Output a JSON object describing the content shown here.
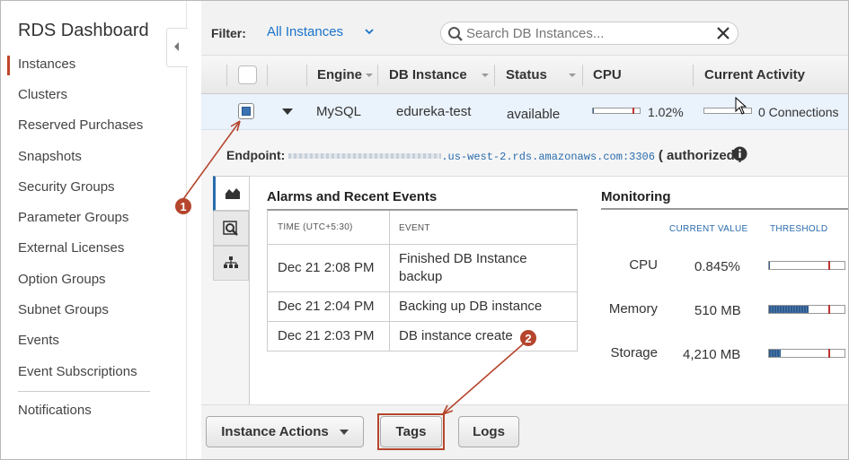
{
  "sidebar": {
    "title": "RDS Dashboard",
    "items": [
      {
        "label": "Instances"
      },
      {
        "label": "Clusters"
      },
      {
        "label": "Reserved Purchases"
      },
      {
        "label": "Snapshots"
      },
      {
        "label": "Security Groups"
      },
      {
        "label": "Parameter Groups"
      },
      {
        "label": "External Licenses"
      },
      {
        "label": "Option Groups"
      },
      {
        "label": "Subnet Groups"
      },
      {
        "label": "Events"
      },
      {
        "label": "Event Subscriptions"
      },
      {
        "label": "Notifications"
      }
    ],
    "active": "Instances"
  },
  "filter": {
    "label": "Filter:",
    "value": "All Instances",
    "search_placeholder": "Search DB Instances..."
  },
  "table": {
    "columns": [
      "Engine",
      "DB Instance",
      "Status",
      "CPU",
      "Current Activity"
    ],
    "row": {
      "engine": "MySQL",
      "db_instance": "edureka-test",
      "status": "available",
      "cpu": "1.02%",
      "cpu_fraction": 0.0102,
      "activity": "0 Connections",
      "activity_fraction": 0
    }
  },
  "detail": {
    "endpoint_label": "Endpoint:",
    "endpoint_host": ".us-west-2.rds.amazonaws.com:3306",
    "endpoint_status": "( authorized )",
    "alarms_title": "Alarms and Recent Events",
    "events_header": {
      "time": "TIME (UTC+5:30)",
      "event": "EVENT"
    },
    "events": [
      {
        "time": "Dec 21 2:08 PM",
        "event_line1": "Finished DB Instance",
        "event_line2": "backup"
      },
      {
        "time": "Dec 21 2:04 PM",
        "event_line1": "Backing up DB instance",
        "event_line2": ""
      },
      {
        "time": "Dec 21 2:03 PM",
        "event_line1": "DB instance create",
        "event_line2": ""
      }
    ],
    "monitoring_title": "Monitoring",
    "monitoring_header": {
      "current": "CURRENT VALUE",
      "threshold": "THRESHOLD"
    },
    "monitoring": [
      {
        "label": "CPU",
        "value": "0.845%",
        "fraction": 0.00845
      },
      {
        "label": "Memory",
        "value": "510 MB",
        "fraction": 0.52
      },
      {
        "label": "Storage",
        "value": "4,210 MB",
        "fraction": 0.16
      }
    ]
  },
  "actions": {
    "instance_actions": "Instance Actions",
    "tags": "Tags",
    "logs": "Logs"
  },
  "annotations": {
    "marker1": "1",
    "marker2": "2"
  },
  "colors": {
    "accent": "#1a73c9",
    "highlight": "#b5452c",
    "bar_fill": "#2e5c8f",
    "threshold": "#b33333"
  }
}
